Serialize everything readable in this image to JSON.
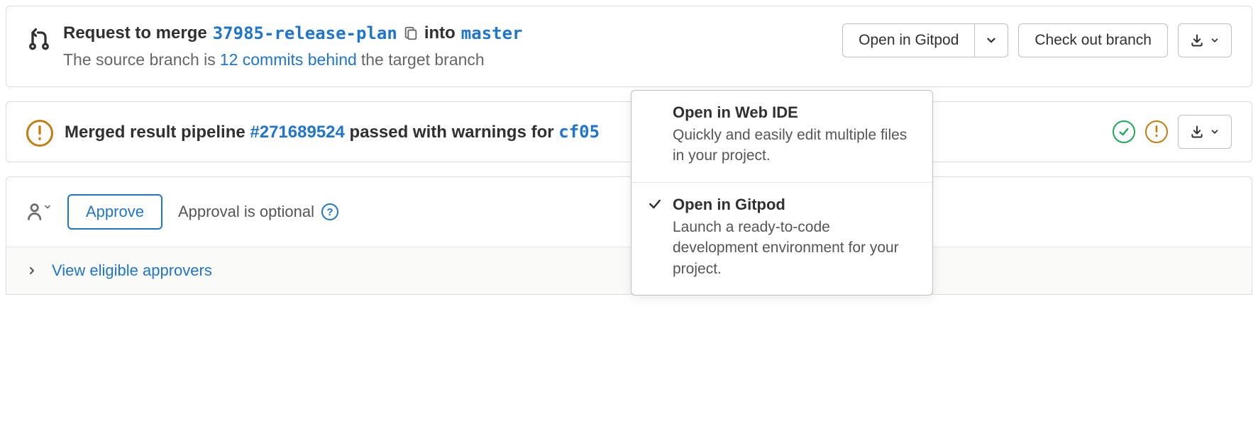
{
  "merge_request": {
    "title_prefix": "Request to merge",
    "source_branch": "37985-release-plan",
    "into_text": "into",
    "target_branch": "master",
    "behind_prefix": "The source branch is",
    "behind_link": "12 commits behind",
    "behind_suffix": "the target branch",
    "actions": {
      "open_in_label": "Open in Gitpod",
      "checkout_label": "Check out branch"
    },
    "dropdown": {
      "options": [
        {
          "title": "Open in Web IDE",
          "desc": "Quickly and easily edit multiple files in your project.",
          "selected": false
        },
        {
          "title": "Open in Gitpod",
          "desc": "Launch a ready-to-code development environment for your project.",
          "selected": true
        }
      ]
    }
  },
  "pipeline": {
    "leading_text": "Merged result pipeline",
    "id": "#271689524",
    "middle_text": "passed with warnings for",
    "commit_ref": "cf05"
  },
  "approval": {
    "approve_label": "Approve",
    "note_text": "Approval is optional",
    "view_approvers_label": "View eligible approvers"
  }
}
